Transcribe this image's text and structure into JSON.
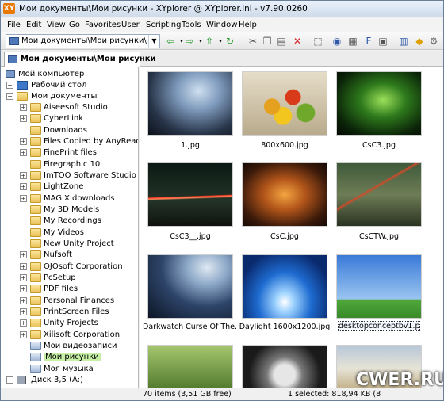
{
  "window": {
    "title": "Мои документы\\Мои рисунки - XYplorer @ XYplorer.ini - v7.90.0260",
    "app_icon": "XY"
  },
  "menu": [
    "File",
    "Edit",
    "View",
    "Go",
    "Favorites",
    "User",
    "Scripting",
    "Tools",
    "Window",
    "Help"
  ],
  "address": {
    "value": "Мои документы\\Мои рисунки\\"
  },
  "toolbar_icons": [
    "back-arrow-icon",
    "back-dropdown-icon",
    "forward-arrow-icon",
    "forward-dropdown-icon",
    "up-folder-icon",
    "up-dropdown-icon",
    "refresh-icon",
    "cut-icon",
    "copy-icon",
    "paste-icon",
    "delete-icon",
    "select-icon",
    "find-icon",
    "preview-icon",
    "tree-icon",
    "panel-icon",
    "catalog-icon",
    "tags-icon",
    "settings-icon"
  ],
  "tab": {
    "label": "Мои документы\\Мои рисунки"
  },
  "tree": {
    "my_computer": "Мой компьютер",
    "desktop": "Рабочий стол",
    "my_documents": "Мои документы",
    "folders": [
      "Aiseesoft Studio",
      "CyberLink",
      "Downloads",
      "Files Copied by AnyReade",
      "FinePrint files",
      "Firegraphic 10",
      "ImTOO Software Studio",
      "LightZone",
      "MAGIX downloads",
      "My 3D Models",
      "My Recordings",
      "My Videos",
      "New Unity Project",
      "Nufsoft",
      "OJOsoft Corporation",
      "PcSetup",
      "PDF files",
      "Personal Finances",
      "PrintScreen Files",
      "Unity Projects",
      "Xilisoft Corporation",
      "Мои видеозаписи",
      "Мои рисунки",
      "Моя музыка"
    ],
    "floppy": "Диск 3,5 (A:)"
  },
  "thumbnails": [
    {
      "label": "1.jpg"
    },
    {
      "label": "800x600.jpg"
    },
    {
      "label": "CsC3.jpg"
    },
    {
      "label": "CsC3__.jpg"
    },
    {
      "label": "CsC.jpg"
    },
    {
      "label": "CsCTW.jpg"
    },
    {
      "label": "Darkwatch Curse Of The..."
    },
    {
      "label": "Daylight 1600x1200.jpg"
    },
    {
      "label": "desktopconceptbv1.png"
    },
    {
      "label": ""
    },
    {
      "label": ""
    },
    {
      "label": ""
    }
  ],
  "status": {
    "left": "70 items (3,51 GB free)",
    "right": "1 selected: 818,94 KB (8"
  },
  "watermark": "CWER.RU",
  "colors": {
    "selection": "#c7f0a6",
    "folder": "#e9c35a"
  }
}
